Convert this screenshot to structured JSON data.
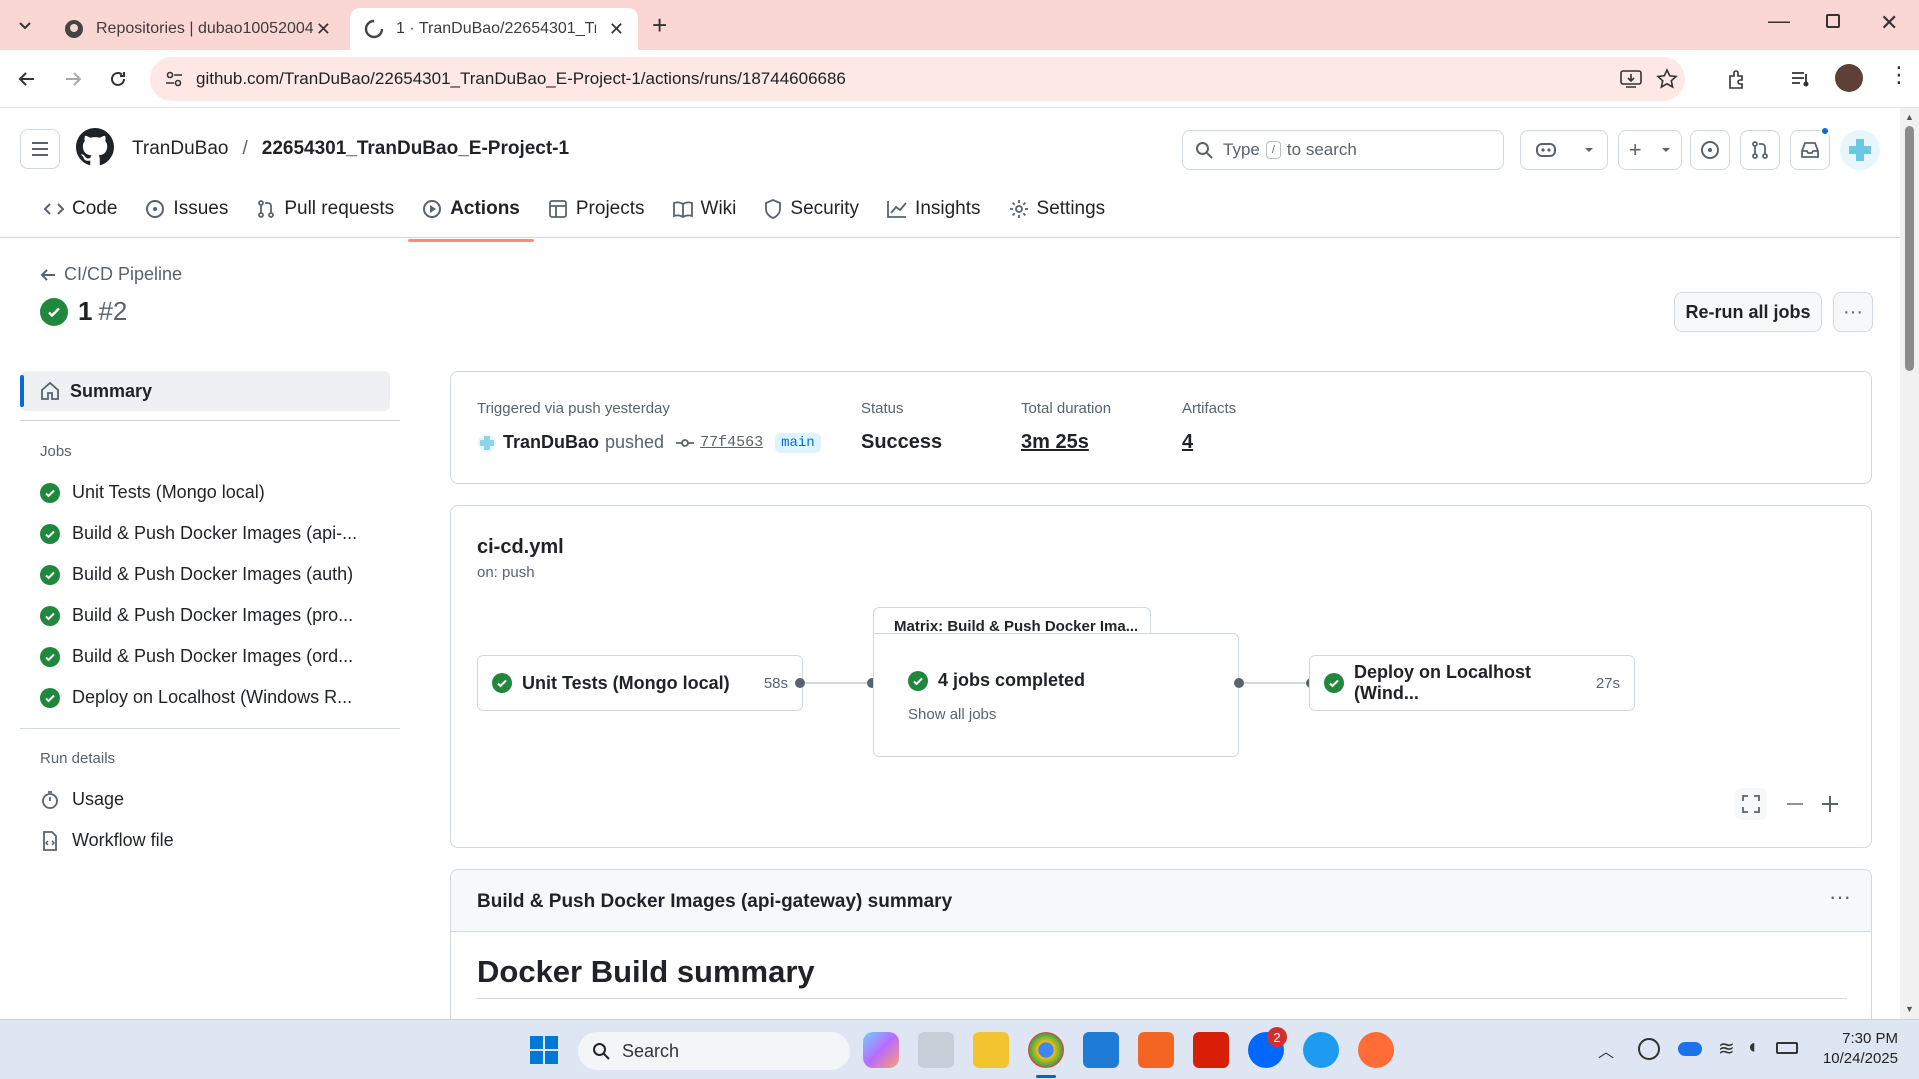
{
  "browser": {
    "tabs": [
      {
        "title": "Repositories | dubao10052004"
      },
      {
        "title": "1 · TranDuBao/22654301_TranDuBao_E-Project-1"
      }
    ],
    "url": "github.com/TranDuBao/22654301_TranDuBao_E-Project-1/actions/runs/18744606686"
  },
  "header": {
    "owner": "TranDuBao",
    "separator": "/",
    "repo": "22654301_TranDuBao_E-Project-1",
    "search_prefix": "Type",
    "search_key": "/",
    "search_suffix": "to search"
  },
  "repo_nav": {
    "code": "Code",
    "issues": "Issues",
    "pull_requests": "Pull requests",
    "actions": "Actions",
    "projects": "Projects",
    "wiki": "Wiki",
    "security": "Security",
    "insights": "Insights",
    "settings": "Settings"
  },
  "run": {
    "back_label": "CI/CD Pipeline",
    "title": "1",
    "number": "#2",
    "rerun_label": "Re-run all jobs"
  },
  "sidebar": {
    "summary": "Summary",
    "jobs_heading": "Jobs",
    "jobs": [
      {
        "label": "Unit Tests (Mongo local)"
      },
      {
        "label": "Build & Push Docker Images (api-..."
      },
      {
        "label": "Build & Push Docker Images (auth)"
      },
      {
        "label": "Build & Push Docker Images (pro..."
      },
      {
        "label": "Build & Push Docker Images (ord..."
      },
      {
        "label": "Deploy on Localhost (Windows R..."
      }
    ],
    "run_details_heading": "Run details",
    "usage": "Usage",
    "workflow_file": "Workflow file"
  },
  "summary": {
    "triggered": "Triggered via push yesterday",
    "actor": "TranDuBao",
    "pushed": "pushed",
    "commit": "77f4563",
    "branch": "main",
    "status_label": "Status",
    "status_value": "Success",
    "duration_label": "Total duration",
    "duration_value": "3m 25s",
    "artifacts_label": "Artifacts",
    "artifacts_value": "4"
  },
  "graph": {
    "file": "ci-cd.yml",
    "trigger": "on: push",
    "job1_name": "Unit Tests (Mongo local)",
    "job1_time": "58s",
    "matrix_title": "Matrix: Build & Push Docker Ima...",
    "matrix_status": "4 jobs completed",
    "matrix_link": "Show all jobs",
    "job3_name": "Deploy on Localhost (Wind...",
    "job3_time": "27s"
  },
  "build_summary": {
    "heading": "Build & Push Docker Images (api-gateway) summary",
    "title": "Docker Build summary"
  },
  "taskbar": {
    "search": "Search",
    "time": "7:30 PM",
    "date": "10/24/2025",
    "badge": "2"
  },
  "colors": {
    "success": "#1f883d",
    "tab_bg": "#fbd7d4",
    "accent_underline": "#fd8c73"
  }
}
